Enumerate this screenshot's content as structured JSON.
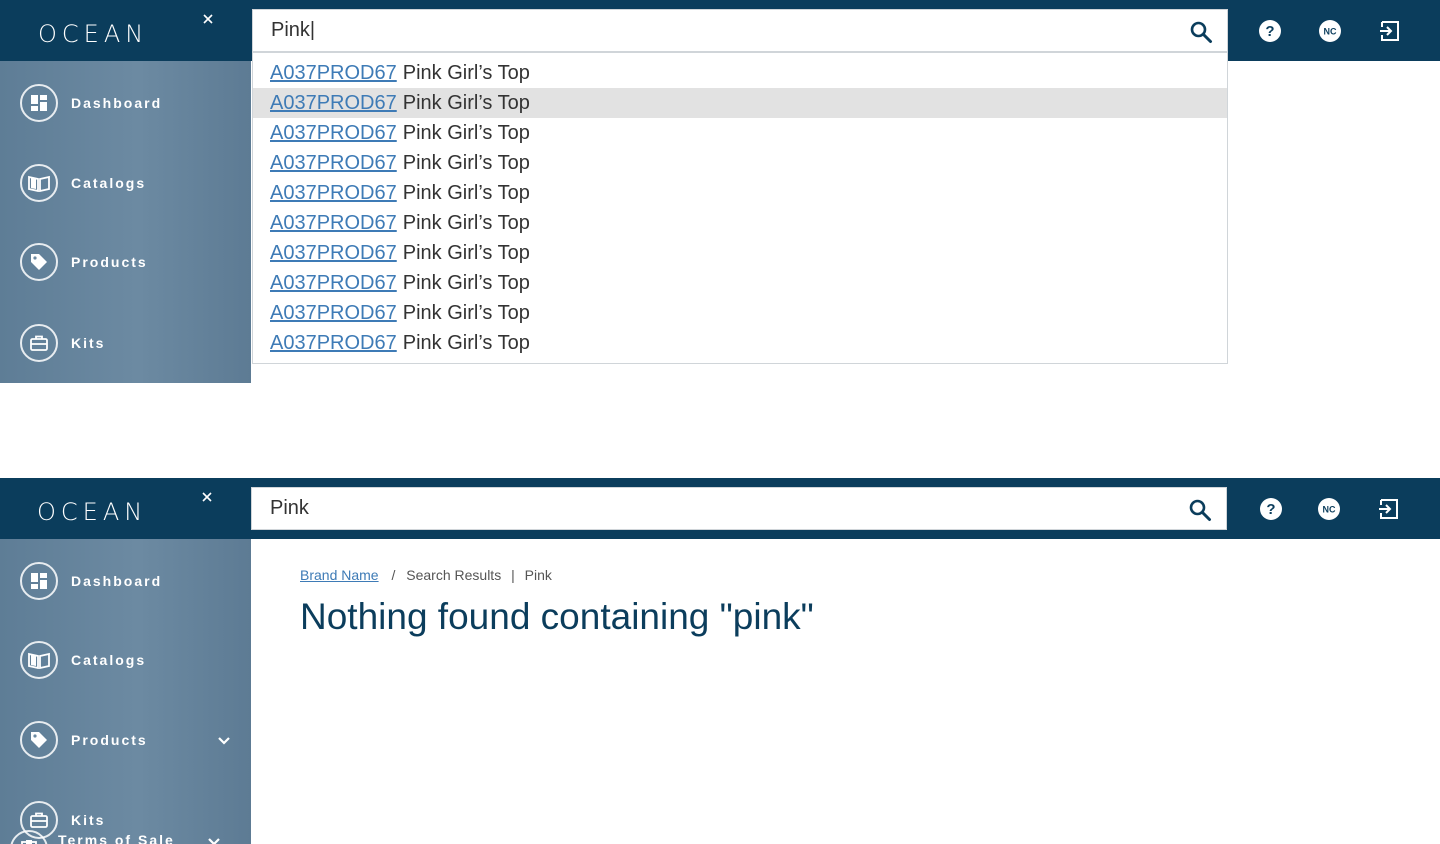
{
  "app": {
    "logo_text": "OCEAN"
  },
  "top_screen": {
    "search": {
      "value": "Pink|"
    },
    "nav": [
      {
        "label": "Dashboard",
        "icon": "dashboard-icon"
      },
      {
        "label": "Catalogs",
        "icon": "catalog-book-icon"
      },
      {
        "label": "Products",
        "icon": "tag-icon"
      },
      {
        "label": "Kits",
        "icon": "briefcase-icon"
      }
    ],
    "suggestions": [
      {
        "code": "A037PROD67",
        "name": "Pink Girl’s Top"
      },
      {
        "code": "A037PROD67",
        "name": "Pink Girl’s Top"
      },
      {
        "code": "A037PROD67",
        "name": "Pink Girl’s Top"
      },
      {
        "code": "A037PROD67",
        "name": "Pink Girl’s Top"
      },
      {
        "code": "A037PROD67",
        "name": "Pink Girl’s Top"
      },
      {
        "code": "A037PROD67",
        "name": "Pink Girl’s Top"
      },
      {
        "code": "A037PROD67",
        "name": "Pink Girl’s Top"
      },
      {
        "code": "A037PROD67",
        "name": "Pink Girl’s Top"
      },
      {
        "code": "A037PROD67",
        "name": "Pink Girl’s Top"
      },
      {
        "code": "A037PROD67",
        "name": "Pink Girl’s Top"
      }
    ],
    "highlighted_index": 1
  },
  "bottom_screen": {
    "search": {
      "value": "Pink"
    },
    "nav": [
      {
        "label": "Dashboard",
        "icon": "dashboard-icon"
      },
      {
        "label": "Catalogs",
        "icon": "catalog-book-icon"
      },
      {
        "label": "Products",
        "icon": "tag-icon"
      },
      {
        "label": "Kits",
        "icon": "briefcase-icon"
      },
      {
        "label": "Terms of Sale",
        "icon": "clipboard-icon"
      }
    ],
    "breadcrumb": {
      "link": "Brand Name",
      "separator": "/",
      "section": "Search Results",
      "divider": "|",
      "query": "Pink"
    },
    "heading": "Nothing found containing \"pink\""
  },
  "header_icons": {
    "help": "help-icon",
    "user_initials": "NC",
    "logout": "logout-icon"
  },
  "colors": {
    "header_bg": "#0b3d5c",
    "sidebar_bg": "#6c8aa2",
    "link": "#3e7bb6",
    "heading": "#0b3d5c",
    "highlight": "#e2e2e2"
  }
}
